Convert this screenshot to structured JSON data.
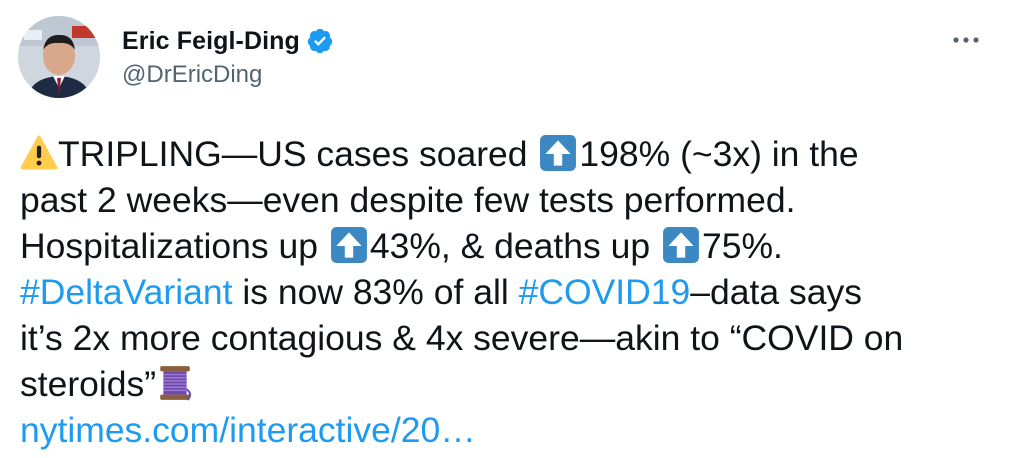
{
  "author": {
    "name": "Eric Feigl-Ding",
    "handle": "@DrEricDing"
  },
  "icons": {
    "verified": "verified-badge-icon",
    "more": "more-options-icon",
    "warning": "warning-emoji",
    "arrow_up": "up-arrow-emoji",
    "thread": "thread-spool-emoji"
  },
  "tweet": {
    "line1_a": "TRIPLING—US cases soared ",
    "line1_b": "198% (~3x) in the",
    "line2": "past 2 weeks—even despite few tests performed.",
    "line3_a": "Hospitalizations up ",
    "line3_b": "43%, & deaths up ",
    "line3_c": "75%.",
    "hashtag1": "#DeltaVariant",
    "line4_mid": " is now 83% of all ",
    "hashtag2": "#COVID19",
    "line4_end": "–data says",
    "line5": "it’s 2x more contagious & 4x severe—akin to “COVID on",
    "line6": "steroids”",
    "link": "nytimes.com/interactive/20…"
  },
  "colors": {
    "link": "#1d9bf0",
    "verified": "#1d9bf0",
    "secondary_text": "#536471"
  }
}
